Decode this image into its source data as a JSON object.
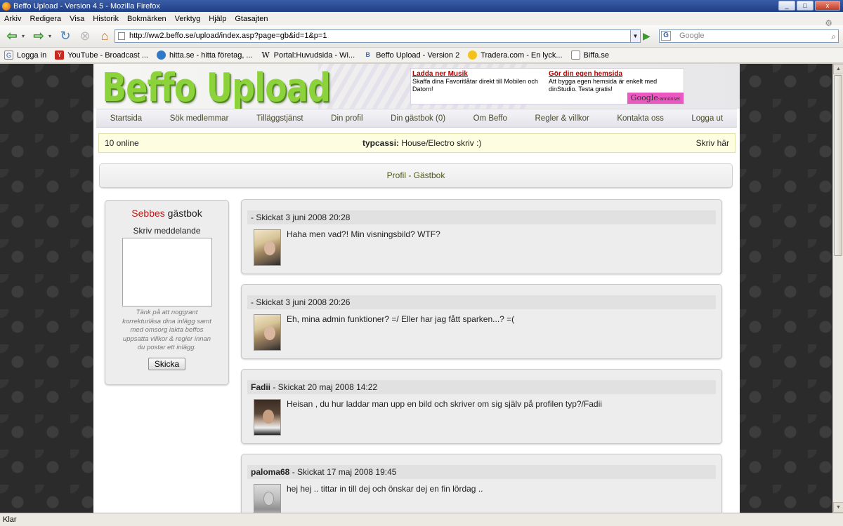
{
  "window": {
    "title": "Beffo Upload - Version 4.5 - Mozilla Firefox",
    "min": "_",
    "max": "□",
    "close": "x"
  },
  "menu": [
    "Arkiv",
    "Redigera",
    "Visa",
    "Historik",
    "Bokmärken",
    "Verktyg",
    "Hjälp",
    "Gtasajten"
  ],
  "toolbar": {
    "url": "http://ww2.beffo.se/upload/index.asp?page=gb&id=1&p=1",
    "search_placeholder": "Google"
  },
  "bookmarks": [
    {
      "label": "Logga in",
      "icon": "google-icon"
    },
    {
      "label": "YouTube - Broadcast ...",
      "icon": "youtube-icon"
    },
    {
      "label": "hitta.se - hitta företag, ...",
      "icon": "globe-icon"
    },
    {
      "label": "Portal:Huvudsida - Wi...",
      "icon": "wikipedia-icon"
    },
    {
      "label": "Beffo Upload - Version 2",
      "icon": "beffo-icon"
    },
    {
      "label": "Tradera.com - En lyck...",
      "icon": "tradera-icon"
    },
    {
      "label": "Biffa.se",
      "icon": "page-icon"
    }
  ],
  "site": {
    "logo": "Beffo Upload",
    "ad": {
      "left_title": "Ladda ner Musik",
      "left_text": "Skaffa dina Favoritlåtar direkt till Mobilen och Datorn!",
      "right_title": "Gör din egen hemsida",
      "right_text": "Att bygga egen hemsida är enkelt med dinStudio. Testa gratis!",
      "badge_brand": "Google",
      "badge_text": "-annonser"
    },
    "nav": [
      "Startsida",
      "Sök medlemmar",
      "Tilläggstjänst",
      "Din profil",
      "Din gästbok (0)",
      "Om Beffo",
      "Regler & villkor",
      "Kontakta oss",
      "Logga ut"
    ],
    "online": {
      "count": "10 online",
      "user": "typcassi:",
      "status": "House/Electro skriv :)",
      "write": "Skriv här"
    },
    "breadcrumb": "Profil - Gästbok",
    "guestbook": {
      "owner": "Sebbes",
      "title_suffix": " gästbok",
      "write_label": "Skriv meddelande",
      "note": "Tänk på att noggrant korrekturläsa dina inlägg samt med omsorg iakta beffos uppsatta villkor & regler innan du postar ett inlägg.",
      "submit": "Skicka"
    },
    "posts": [
      {
        "author": "",
        "meta": "- Skickat 3 juni 2008 20:28",
        "message": "Haha men vad?! Min visningsbild? WTF?"
      },
      {
        "author": "",
        "meta": "- Skickat 3 juni 2008 20:26",
        "message": "Eh, mina admin funktioner? =/ Eller har jag fått sparken...? =("
      },
      {
        "author": "Fadii",
        "meta": " - Skickat 20 maj 2008 14:22",
        "message": "Heisan , du hur laddar man upp en bild och skriver om sig själv på profilen typ?/Fadii"
      },
      {
        "author": "paloma68",
        "meta": " - Skickat 17 maj 2008 19:45",
        "message": "hej hej .. tittar in till dej och önskar dej en fin lördag .."
      }
    ]
  },
  "status": "Klar"
}
